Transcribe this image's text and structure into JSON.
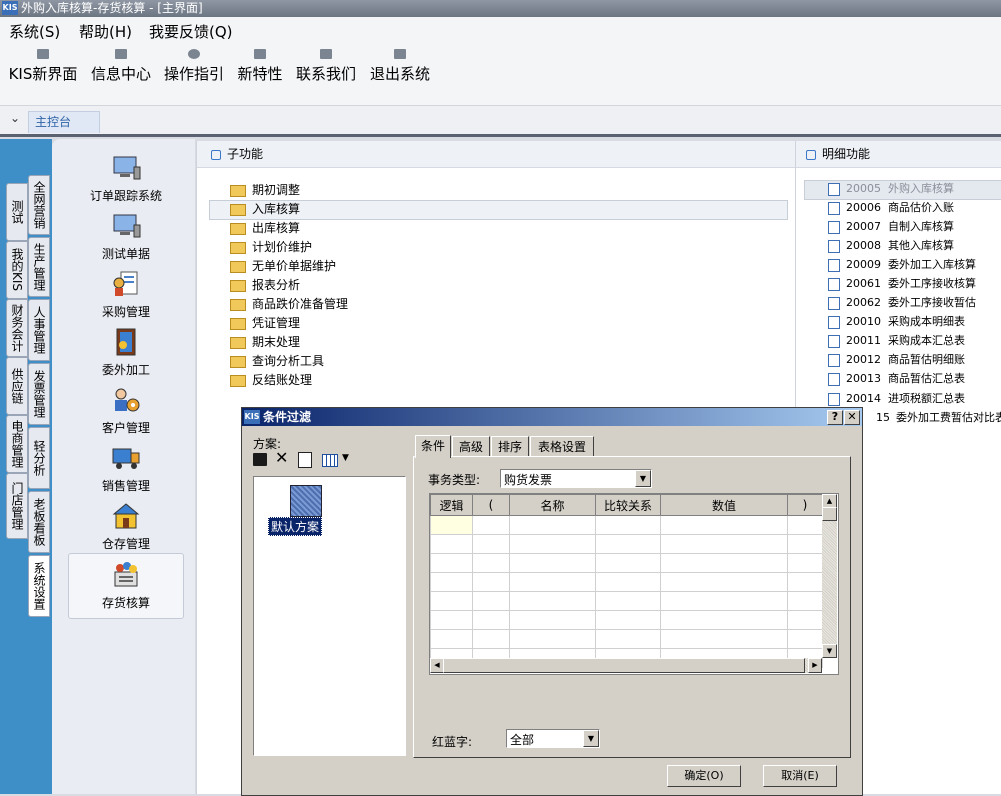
{
  "window": {
    "app_badge": "KIS",
    "title": "外购入库核算-存货核算 - [主界面]"
  },
  "menu": [
    "系统(S)",
    "帮助(H)",
    "我要反馈(Q)"
  ],
  "toolbar": [
    "KIS新界面",
    "信息中心",
    "操作指引",
    "新特性",
    "联系我们",
    "退出系统"
  ],
  "tabs": {
    "chevron": "⌄",
    "main": "主控台"
  },
  "side_tabs_outer": [
    "测试",
    "我的KIS",
    "财务会计",
    "供应链",
    "电商管理",
    "门店管理"
  ],
  "side_tabs_inner": [
    "全网营销",
    "生产管理",
    "人事管理",
    "发票管理",
    "轻分析",
    "老板看板",
    "系统设置"
  ],
  "nav_items": [
    "订单跟踪系统",
    "测试单据",
    "采购管理",
    "委外加工",
    "客户管理",
    "销售管理",
    "仓存管理",
    "存货核算"
  ],
  "subfunc": {
    "title": "子功能",
    "items": [
      "期初调整",
      "入库核算",
      "出库核算",
      "计划价维护",
      "无单价单据维护",
      "报表分析",
      "商品跌价准备管理",
      "凭证管理",
      "期末处理",
      "查询分析工具",
      "反结账处理"
    ],
    "selected_index": 1
  },
  "detail": {
    "title": "明细功能",
    "items": [
      {
        "code": "20005",
        "name": "外购入库核算"
      },
      {
        "code": "20006",
        "name": "商品估价入账"
      },
      {
        "code": "20007",
        "name": "自制入库核算"
      },
      {
        "code": "20008",
        "name": "其他入库核算"
      },
      {
        "code": "20009",
        "name": "委外加工入库核算"
      },
      {
        "code": "20061",
        "name": "委外工序接收核算"
      },
      {
        "code": "20062",
        "name": "委外工序接收暂估"
      },
      {
        "code": "20010",
        "name": "采购成本明细表"
      },
      {
        "code": "20011",
        "name": "采购成本汇总表"
      },
      {
        "code": "20012",
        "name": "商品暂估明细账"
      },
      {
        "code": "20013",
        "name": "商品暂估汇总表"
      },
      {
        "code": "20014",
        "name": "进项税额汇总表"
      },
      {
        "code": "15",
        "name": "委外加工费暂估对比表"
      }
    ]
  },
  "dialog": {
    "badge": "KIS",
    "title": "条件过滤",
    "help_btn": "?",
    "close_btn": "✕",
    "scheme_label": "方案:",
    "default_scheme": "默认方案",
    "tabs": [
      "条件",
      "高级",
      "排序",
      "表格设置"
    ],
    "biz_type_label": "事务类型:",
    "biz_type_value": "购货发票",
    "grid_headers": [
      "逻辑",
      "(",
      "名称",
      "比较关系",
      "数值",
      ")"
    ],
    "redblue_label": "红蓝字:",
    "redblue_value": "全部",
    "ok_label": "确定(O)",
    "cancel_label": "取消(E)"
  }
}
